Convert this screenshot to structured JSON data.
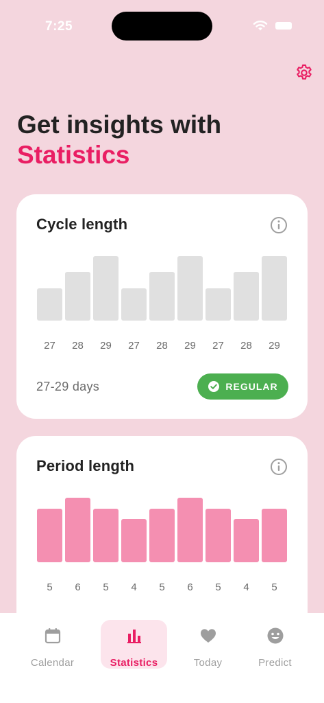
{
  "status_bar": {
    "time": "7:25"
  },
  "header": {
    "line1": "Get insights with",
    "line2": "Statistics",
    "settings_icon": "gear-icon"
  },
  "colors": {
    "accent": "#E91E63",
    "background": "#F4D6DE",
    "cycle_bar": "#E0E0E0",
    "period_bar": "#F48FB1",
    "regular_badge": "#4CAF50"
  },
  "cycle_card": {
    "title": "Cycle length",
    "range_text": "27-29 days",
    "badge_label": "REGULAR",
    "chart_data": {
      "type": "bar",
      "categories": [
        "27",
        "28",
        "29",
        "27",
        "28",
        "29",
        "27",
        "28",
        "29"
      ],
      "values": [
        27,
        28,
        29,
        27,
        28,
        29,
        27,
        28,
        29
      ],
      "ylim": [
        26,
        29
      ]
    }
  },
  "period_card": {
    "title": "Period length",
    "chart_data": {
      "type": "bar",
      "categories": [
        "5",
        "6",
        "5",
        "4",
        "5",
        "6",
        "5",
        "4",
        "5"
      ],
      "values": [
        5,
        6,
        5,
        4,
        5,
        6,
        5,
        4,
        5
      ],
      "ylim": [
        0,
        6
      ]
    }
  },
  "tabs": [
    {
      "label": "Calendar",
      "icon": "calendar-icon",
      "active": false
    },
    {
      "label": "Statistics",
      "icon": "bar-chart-icon",
      "active": true
    },
    {
      "label": "Today",
      "icon": "heart-icon",
      "active": false
    },
    {
      "label": "Predict",
      "icon": "smiley-icon",
      "active": false
    }
  ]
}
